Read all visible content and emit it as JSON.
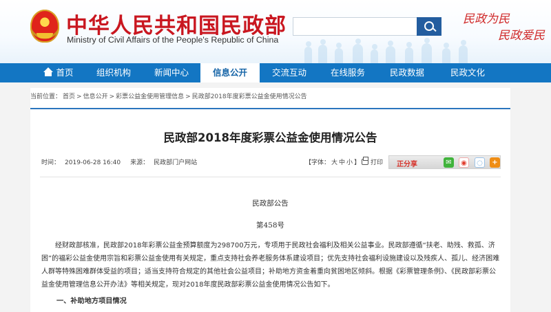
{
  "header": {
    "title_cn": "中华人民共和国民政部",
    "title_en": "Ministry of Civil Affairs of the People's Republic of China",
    "search_placeholder": "",
    "slogan_line1": "民政为民",
    "slogan_line2": "民政爱民"
  },
  "nav": {
    "items": [
      {
        "label": "首页",
        "icon": "home-icon"
      },
      {
        "label": "组织机构"
      },
      {
        "label": "新闻中心"
      },
      {
        "label": "信息公开",
        "active": true
      },
      {
        "label": "交流互动"
      },
      {
        "label": "在线服务"
      },
      {
        "label": "民政数据"
      },
      {
        "label": "民政文化"
      }
    ]
  },
  "breadcrumb": {
    "prefix": "当前位置：",
    "items": [
      "首页",
      "信息公开",
      "彩票公益金使用管理信息",
      "民政部2018年度彩票公益金使用情况公告"
    ],
    "separator": ">"
  },
  "article": {
    "title": "民政部2018年度彩票公益金使用情况公告",
    "meta_time_label": "时间：",
    "meta_time": "2019-06-28 16:40",
    "meta_source_label": "来源：",
    "meta_source": "民政部门户网站",
    "font_size_label": "【字体：",
    "font_large": "大",
    "font_medium": "中",
    "font_small": "小",
    "font_close": "】",
    "print_label": "打印",
    "share_label": "正分享",
    "share_more": "+",
    "issuer": "民政部公告",
    "number": "第458号",
    "paragraph": "经财政部核准，民政部2018年彩票公益金预算额度为298700万元，专项用于民政社会福利及相关公益事业。民政部遵循“扶老、助残、救孤、济困”的福彩公益金使用宗旨和彩票公益金使用有关规定，重点支持社会养老服务体系建设项目；优先支持社会福利设施建设以及残疾人、孤儿、经济困难人群等特殊困难群体受益的项目；适当支持符合规定的其他社会公益项目；补助地方资金着重向贫困地区倾斜。根据《彩票管理条例》、《民政部彩票公益金使用管理信息公开办法》等相关规定，现对2018年度民政部彩票公益金使用情况公告如下。",
    "section_heading": "一、补助地方项目情况"
  },
  "colors": {
    "brand_red": "#c91720",
    "nav_blue": "#1376c3",
    "rule_blue": "#2a75bd",
    "share_red": "#d6342c"
  }
}
